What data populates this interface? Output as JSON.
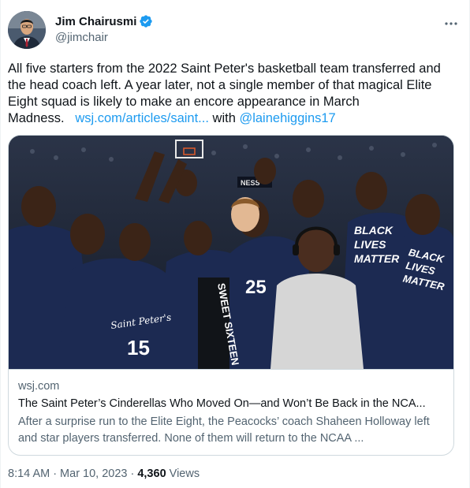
{
  "author": {
    "display_name": "Jim Chairusmi",
    "handle": "@jimchair",
    "verified_icon": "verified-badge-icon",
    "more_icon": "more-dots-icon"
  },
  "tweet": {
    "text_main": "All five starters from the 2022 Saint Peter's basketball team transferred and the head coach left. A year later, not a single member of that magical Elite Eight squad is likely to make an encore appearance in March Madness.",
    "link_text": "wsj.com/articles/saint...",
    "with_text": "with",
    "mention": "@lainehiggins17"
  },
  "card": {
    "domain": "wsj.com",
    "title": "The Saint Peter’s Cinderellas Who Moved On—and Won’t Be Back in the NCA...",
    "description": "After a surprise run to the Elite Eight, the Peacocks’ coach Shaheen Holloway left and star players transferred. None of them will return to the NCAA ...",
    "image_texts": {
      "shirt_right_1": "BLACK",
      "shirt_right_2": "LIVES",
      "shirt_right_3": "MATTER",
      "shirt_far_right_1": "BLACK",
      "shirt_far_right_2": "LIVES",
      "shirt_far_right_3": "MATTER",
      "jersey_script": "Saint Peter's",
      "jersey_number_left": "15",
      "jersey_number_mid": "25",
      "banner": "SWEET SIXTEEN"
    }
  },
  "meta": {
    "time": "8:14 AM",
    "date": "Mar 10, 2023",
    "views_count": "4,360",
    "views_label": "Views"
  },
  "colors": {
    "accent": "#1d9bf0",
    "text_primary": "#0f1419",
    "text_secondary": "#536471",
    "border": "#cfd9de"
  }
}
